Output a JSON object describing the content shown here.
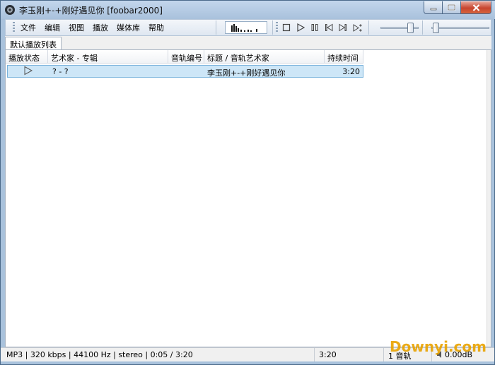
{
  "window": {
    "title": "李玉刚+-+刚好遇见你  [foobar2000]",
    "accent": "#4b6a8a"
  },
  "menu": {
    "items": [
      "文件",
      "编辑",
      "视图",
      "播放",
      "媒体库",
      "帮助"
    ]
  },
  "transport": {
    "stop_icon": "stop-icon",
    "play_icon": "play-icon",
    "pause_icon": "pause-icon",
    "prev_icon": "previous-icon",
    "next_icon": "next-icon",
    "random_icon": "random-icon"
  },
  "volume": {
    "level": 0.85
  },
  "seek": {
    "position": 0.026
  },
  "tabs": {
    "active": "默认播放列表"
  },
  "playlist": {
    "columns": [
      "播放状态",
      "艺术家 - 专辑",
      "音轨编号",
      "标题 / 音轨艺术家",
      "持续时间"
    ],
    "rows": [
      {
        "status_icon": "play-icon",
        "artist_album": "? - ?",
        "track_no": "",
        "title": "李玉刚+-+刚好遇见你",
        "duration": "3:20"
      }
    ],
    "selection_color": "#cde6f7"
  },
  "status": {
    "info": "MP3 | 320 kbps | 44100 Hz | stereo | 0:05 / 3:20",
    "total_time": "3:20",
    "track_count": "1 音轨",
    "volume": "0.00dB"
  },
  "watermark": "Downyi.com"
}
